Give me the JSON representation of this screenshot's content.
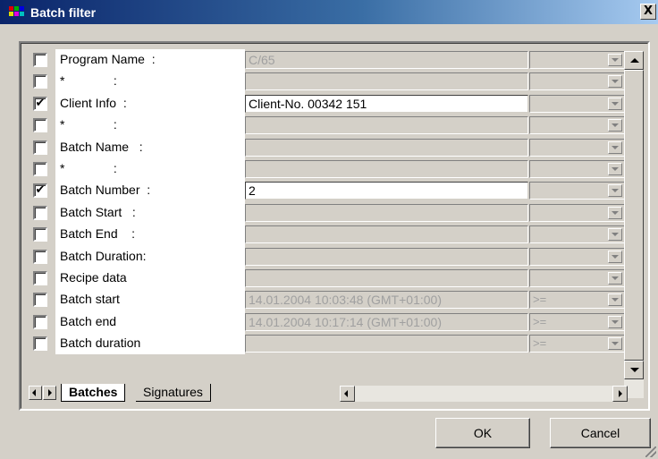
{
  "window": {
    "title": "Batch filter",
    "close_label": "X"
  },
  "rows": [
    {
      "checked": false,
      "label": "Program Name  :",
      "value": "C/65",
      "active": false,
      "op": ""
    },
    {
      "checked": false,
      "label": "*              :",
      "value": "",
      "active": false,
      "op": ""
    },
    {
      "checked": true,
      "label": "Client Info  :",
      "value": "Client-No. 00342 151",
      "active": true,
      "op": ""
    },
    {
      "checked": false,
      "label": "*              :",
      "value": "",
      "active": false,
      "op": ""
    },
    {
      "checked": false,
      "label": "Batch Name   :",
      "value": "",
      "active": false,
      "op": ""
    },
    {
      "checked": false,
      "label": "*              :",
      "value": "",
      "active": false,
      "op": ""
    },
    {
      "checked": true,
      "label": "Batch Number  :",
      "value": "2",
      "active": true,
      "op": ""
    },
    {
      "checked": false,
      "label": "Batch Start   :",
      "value": "",
      "active": false,
      "op": ""
    },
    {
      "checked": false,
      "label": "Batch End    :",
      "value": "",
      "active": false,
      "op": ""
    },
    {
      "checked": false,
      "label": "Batch Duration:",
      "value": "",
      "active": false,
      "op": ""
    },
    {
      "checked": false,
      "label": "Recipe data",
      "value": "",
      "active": false,
      "op": ""
    },
    {
      "checked": false,
      "label": "Batch start",
      "value": "14.01.2004 10:03:48 (GMT+01:00)",
      "active": false,
      "op": ">="
    },
    {
      "checked": false,
      "label": "Batch end",
      "value": "14.01.2004 10:17:14 (GMT+01:00)",
      "active": false,
      "op": ">="
    },
    {
      "checked": false,
      "label": "Batch duration",
      "value": "",
      "active": false,
      "op": ">="
    }
  ],
  "tabs": [
    {
      "label": "Batches",
      "active": true
    },
    {
      "label": "Signatures",
      "active": false
    }
  ],
  "buttons": {
    "ok": "OK",
    "cancel": "Cancel"
  },
  "check_glyph": "✔"
}
